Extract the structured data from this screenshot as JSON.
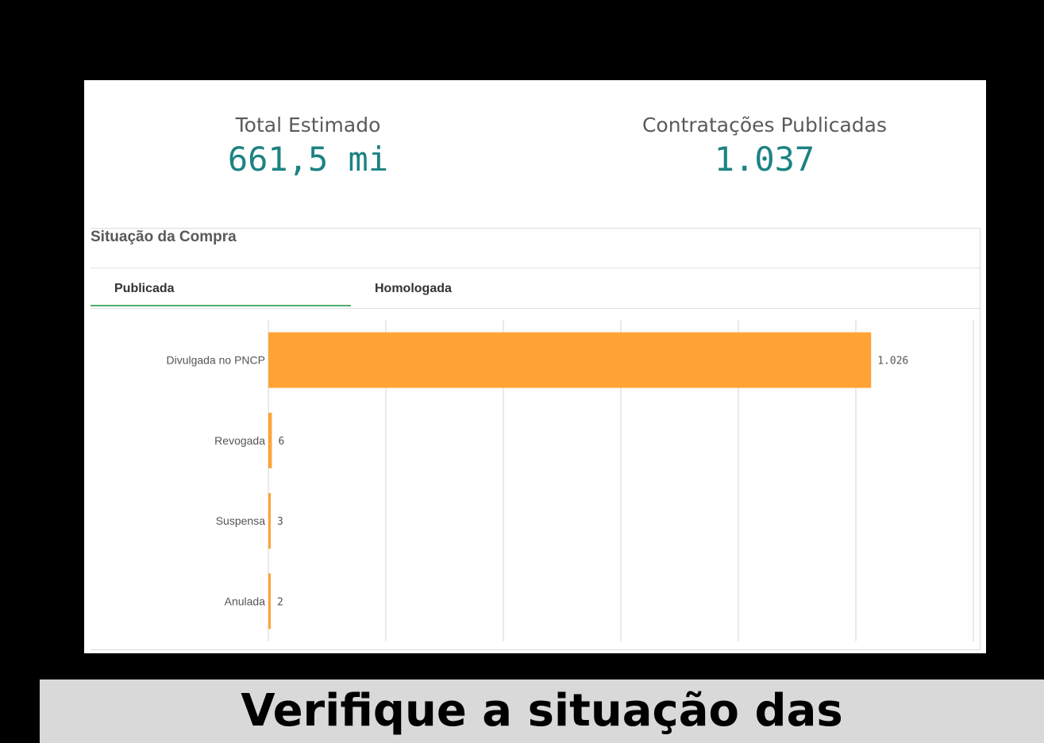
{
  "kpis": {
    "total": {
      "label": "Total Estimado",
      "value": "661,5 mi"
    },
    "contracts": {
      "label": "Contratações Publicadas",
      "value": "1.037"
    }
  },
  "tabs": {
    "active": "Publicada",
    "other": "Homologada"
  },
  "caption": "Verifique a situação das",
  "colors": {
    "bar": "#ffa336",
    "kpi_value": "#1c8382",
    "active_tab": "#4fae6b",
    "grid": "#d6d6d6"
  },
  "chart_data": {
    "type": "bar",
    "orientation": "horizontal",
    "title": "Situação da Compra",
    "categories": [
      "Divulgada no PNCP",
      "Revogada",
      "Suspensa",
      "Anulada"
    ],
    "values": [
      1026,
      6,
      3,
      2
    ],
    "value_labels": [
      "1.026",
      "6",
      "3",
      "2"
    ],
    "xlim": [
      0,
      1200
    ],
    "grid": true
  }
}
